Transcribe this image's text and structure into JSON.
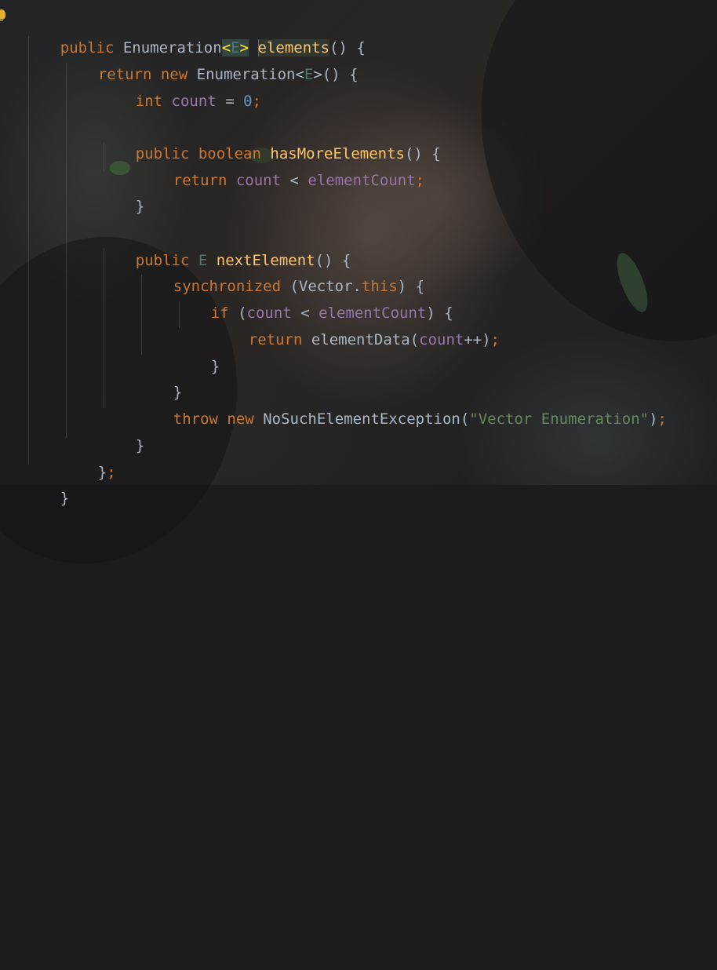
{
  "editor": {
    "theme_colors": {
      "keyword": "#cc7832",
      "field": "#9876aa",
      "number": "#6897bb",
      "method": "#ffc66d",
      "string": "#6a8759",
      "type_param": "#507874",
      "text": "#a9b7c6"
    },
    "gutter_icon": "lightbulb-icon",
    "lines": [
      {
        "t1": "public",
        "t2": " Enumeration",
        "t3": "<",
        "t4": "E",
        "t5": ">",
        "t6": " ",
        "t7": "elements",
        "t8": "() {"
      },
      {
        "t1": "return",
        "t2": " ",
        "t3": "new",
        "t4": " Enumeration<",
        "t5": "E",
        "t6": ">() {"
      },
      {
        "t1": "int",
        "t2": " ",
        "t3": "count",
        "t4": " = ",
        "t5": "0",
        "t6": ";"
      },
      {
        "t1": "public",
        "t2": " ",
        "t3": "boolean",
        "t4": " ",
        "t5": "hasMoreElements",
        "t6": "() {"
      },
      {
        "t1": "return",
        "t2": " ",
        "t3": "count",
        "t4": " < ",
        "t5": "elementCount",
        "t6": ";"
      },
      {
        "t1": "}"
      },
      {
        "t1": "public",
        "t2": " ",
        "t3": "E",
        "t4": " ",
        "t5": "nextElement",
        "t6": "() {"
      },
      {
        "t1": "synchronized",
        "t2": " (Vector.",
        "t3": "this",
        "t4": ") {"
      },
      {
        "t1": "if",
        "t2": " (",
        "t3": "count",
        "t4": " < ",
        "t5": "elementCount",
        "t6": ") {"
      },
      {
        "t1": "return",
        "t2": " elementData(",
        "t3": "count",
        "t4": "++",
        "t5": ")",
        "t6": ";"
      },
      {
        "t1": "}"
      },
      {
        "t1": "}"
      },
      {
        "t1": "throw",
        "t2": " ",
        "t3": "new",
        "t4": " NoSuchElementException(",
        "t5": "\"Vector Enumeration\"",
        "t6": ")",
        "t7": ";"
      },
      {
        "t1": "}"
      },
      {
        "t1": "}",
        "t2": ";"
      },
      {
        "t1": "}"
      }
    ]
  }
}
